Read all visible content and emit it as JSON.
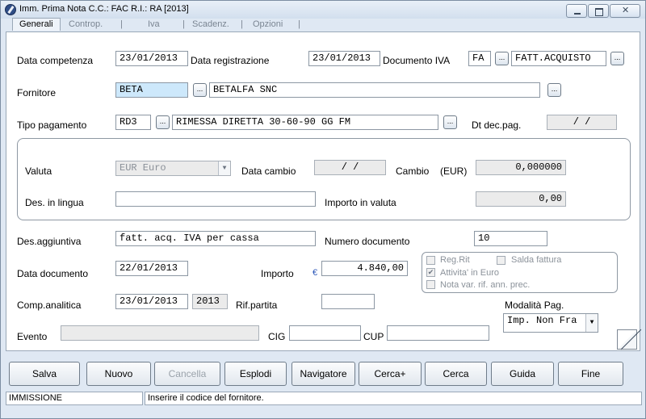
{
  "window": {
    "title": "Imm. Prima Nota C.C.: FAC  R.I.: RA  [2013]"
  },
  "tabs": [
    "Generali",
    "Controp.",
    "Iva",
    "Scadenz.",
    "Opzioni"
  ],
  "form": {
    "data_competenza_label": "Data competenza",
    "data_competenza": "23/01/2013",
    "data_registrazione_label": "Data registrazione",
    "data_registrazione": "23/01/2013",
    "documento_iva_label": "Documento IVA",
    "documento_iva_code": "FA",
    "documento_iva_desc": "FATT.ACQUISTO",
    "fornitore_label": "Fornitore",
    "fornitore_code": "BETA",
    "fornitore_name": "BETALFA SNC",
    "tipo_pagamento_label": "Tipo pagamento",
    "tipo_pagamento_code": "RD3",
    "tipo_pagamento_desc": "RIMESSA DIRETTA 30-60-90 GG FM",
    "dt_dec_pag_label": "Dt dec.pag.",
    "dt_dec_pag": " /  /",
    "valuta_label": "Valuta",
    "valuta": "EUR Euro",
    "data_cambio_label": "Data cambio",
    "data_cambio": " /  /",
    "cambio_label": "Cambio",
    "cambio_unit": "(EUR)",
    "cambio": "0,000000",
    "des_in_lingua_label": "Des. in lingua",
    "des_in_lingua": "",
    "importo_in_valuta_label": "Importo in valuta",
    "importo_in_valuta": "0,00",
    "des_aggiuntiva_label": "Des.aggiuntiva",
    "des_aggiuntiva": "fatt. acq. IVA per cassa",
    "numero_documento_label": "Numero documento",
    "numero_documento": "10",
    "data_documento_label": "Data documento",
    "data_documento": "22/01/2013",
    "importo_label": "Importo",
    "importo_currency": "€",
    "importo": "4.840,00",
    "comp_analitica_label": "Comp.analitica",
    "comp_analitica": "23/01/2013",
    "comp_analitica_year": "2013",
    "rif_partita_label": "Rif.partita",
    "rif_partita": "",
    "modalita_pag_label": "Modalità Pag.",
    "modalita_pag": "Imp. Non Fra",
    "evento_label": "Evento",
    "evento": "",
    "cig_label": "CIG",
    "cig": "",
    "cup_label": "CUP",
    "cup": ""
  },
  "checkboxes": {
    "reg_rit": {
      "label": "Reg.Rit",
      "checked": false
    },
    "salda_fattura": {
      "label": "Salda fattura",
      "checked": false
    },
    "attivita_in_euro": {
      "label": "Attivita' in Euro",
      "checked": true
    },
    "nota_var": {
      "label": "Nota var. rif. ann. prec.",
      "checked": false
    }
  },
  "buttons": {
    "salva": "Salva",
    "nuovo": "Nuovo",
    "cancella": "Cancella",
    "esplodi": "Esplodi",
    "navigatore": "Navigatore",
    "cerca_plus": "Cerca+",
    "cerca": "Cerca",
    "guida": "Guida",
    "fine": "Fine"
  },
  "status": {
    "mode": "IMMISSIONE",
    "message": "Inserire il codice del fornitore."
  }
}
